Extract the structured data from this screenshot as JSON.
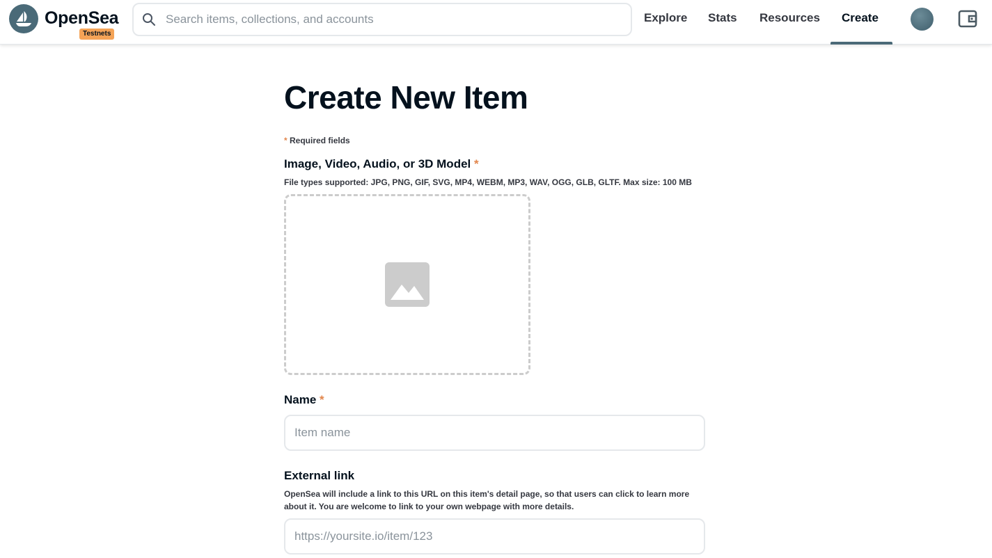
{
  "header": {
    "brand": "OpenSea",
    "badge": "Testnets",
    "search_placeholder": "Search items, collections, and accounts",
    "nav": [
      {
        "label": "Explore"
      },
      {
        "label": "Stats"
      },
      {
        "label": "Resources"
      },
      {
        "label": "Create",
        "active": true
      }
    ],
    "accent_color": "#4b6a78",
    "badge_color": "#f4a357"
  },
  "form": {
    "title": "Create New Item",
    "required_star": "*",
    "required_note": "Required fields",
    "media": {
      "label": "Image, Video, Audio, or 3D Model",
      "star": "*",
      "description": "File types supported: JPG, PNG, GIF, SVG, MP4, WEBM, MP3, WAV, OGG, GLB, GLTF. Max size: 100 MB",
      "icon": "image-placeholder-icon"
    },
    "name": {
      "label": "Name",
      "star": "*",
      "placeholder": "Item name",
      "value": ""
    },
    "external_link": {
      "label": "External link",
      "description": "OpenSea will include a link to this URL on this item's detail page, so that users can click to learn more about it. You are welcome to link to your own webpage with more details.",
      "placeholder": "https://yoursite.io/item/123",
      "value": ""
    },
    "required_color": "#e2864c"
  }
}
